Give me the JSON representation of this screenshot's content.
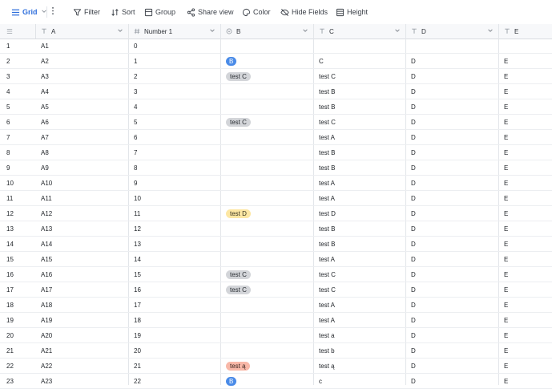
{
  "toolbar": {
    "grid_label": "Grid",
    "filter_label": "Filter",
    "sort_label": "Sort",
    "group_label": "Group",
    "share_label": "Share view",
    "color_label": "Color",
    "hide_label": "Hide Fields",
    "height_label": "Height"
  },
  "columns": [
    {
      "label": "A",
      "type_icon": "text-type-icon"
    },
    {
      "label": "Number 1",
      "type_icon": "number-type-icon"
    },
    {
      "label": "B",
      "type_icon": "single-select-type-icon"
    },
    {
      "label": "C",
      "type_icon": "text-type-icon"
    },
    {
      "label": "D",
      "type_icon": "text-type-icon"
    },
    {
      "label": "E",
      "type_icon": "text-type-icon"
    }
  ],
  "tag_colors": {
    "blue": "#4a8be8",
    "grey": "#d3d5d9",
    "yellow": "#fde7a3",
    "pink": "#f8b8a8"
  },
  "rows": [
    {
      "n": "1",
      "a": "A1",
      "num": "0",
      "b": "",
      "bc": "",
      "c": "",
      "d": "",
      "e": ""
    },
    {
      "n": "2",
      "a": "A2",
      "num": "1",
      "b": "B",
      "bc": "blue",
      "c": "C",
      "d": "D",
      "e": "E"
    },
    {
      "n": "3",
      "a": "A3",
      "num": "2",
      "b": "test C",
      "bc": "grey",
      "c": "test C",
      "d": "D",
      "e": "E"
    },
    {
      "n": "4",
      "a": "A4",
      "num": "3",
      "b": "",
      "bc": "",
      "c": "test B",
      "d": "D",
      "e": "E"
    },
    {
      "n": "5",
      "a": "A5",
      "num": "4",
      "b": "",
      "bc": "",
      "c": "test B",
      "d": "D",
      "e": "E"
    },
    {
      "n": "6",
      "a": "A6",
      "num": "5",
      "b": "test C",
      "bc": "grey",
      "c": "test C",
      "d": "D",
      "e": "E"
    },
    {
      "n": "7",
      "a": "A7",
      "num": "6",
      "b": "",
      "bc": "",
      "c": "test A",
      "d": "D",
      "e": "E"
    },
    {
      "n": "8",
      "a": "A8",
      "num": "7",
      "b": "",
      "bc": "",
      "c": "test B",
      "d": "D",
      "e": "E"
    },
    {
      "n": "9",
      "a": "A9",
      "num": "8",
      "b": "",
      "bc": "",
      "c": "test B",
      "d": "D",
      "e": "E"
    },
    {
      "n": "10",
      "a": "A10",
      "num": "9",
      "b": "",
      "bc": "",
      "c": "test A",
      "d": "D",
      "e": "E"
    },
    {
      "n": "11",
      "a": "A11",
      "num": "10",
      "b": "",
      "bc": "",
      "c": "test A",
      "d": "D",
      "e": "E"
    },
    {
      "n": "12",
      "a": "A12",
      "num": "11",
      "b": "test D",
      "bc": "yellow",
      "c": "test D",
      "d": "D",
      "e": "E"
    },
    {
      "n": "13",
      "a": "A13",
      "num": "12",
      "b": "",
      "bc": "",
      "c": "test B",
      "d": "D",
      "e": "E"
    },
    {
      "n": "14",
      "a": "A14",
      "num": "13",
      "b": "",
      "bc": "",
      "c": "test B",
      "d": "D",
      "e": "E"
    },
    {
      "n": "15",
      "a": "A15",
      "num": "14",
      "b": "",
      "bc": "",
      "c": "test A",
      "d": "D",
      "e": "E"
    },
    {
      "n": "16",
      "a": "A16",
      "num": "15",
      "b": "test C",
      "bc": "grey",
      "c": "test C",
      "d": "D",
      "e": "E"
    },
    {
      "n": "17",
      "a": "A17",
      "num": "16",
      "b": "test C",
      "bc": "grey",
      "c": "test C",
      "d": "D",
      "e": "E"
    },
    {
      "n": "18",
      "a": "A18",
      "num": "17",
      "b": "",
      "bc": "",
      "c": "test A",
      "d": "D",
      "e": "E"
    },
    {
      "n": "19",
      "a": "A19",
      "num": "18",
      "b": "",
      "bc": "",
      "c": "test A",
      "d": "D",
      "e": "E"
    },
    {
      "n": "20",
      "a": "A20",
      "num": "19",
      "b": "",
      "bc": "",
      "c": "test a",
      "d": "D",
      "e": "E"
    },
    {
      "n": "21",
      "a": "A21",
      "num": "20",
      "b": "",
      "bc": "",
      "c": "test b",
      "d": "D",
      "e": "E"
    },
    {
      "n": "22",
      "a": "A22",
      "num": "21",
      "b": "test ą",
      "bc": "pink",
      "c": "test ą",
      "d": "D",
      "e": "E"
    },
    {
      "n": "23",
      "a": "A23",
      "num": "22",
      "b": "B",
      "bc": "blue",
      "c": "c",
      "d": "D",
      "e": "E"
    }
  ]
}
